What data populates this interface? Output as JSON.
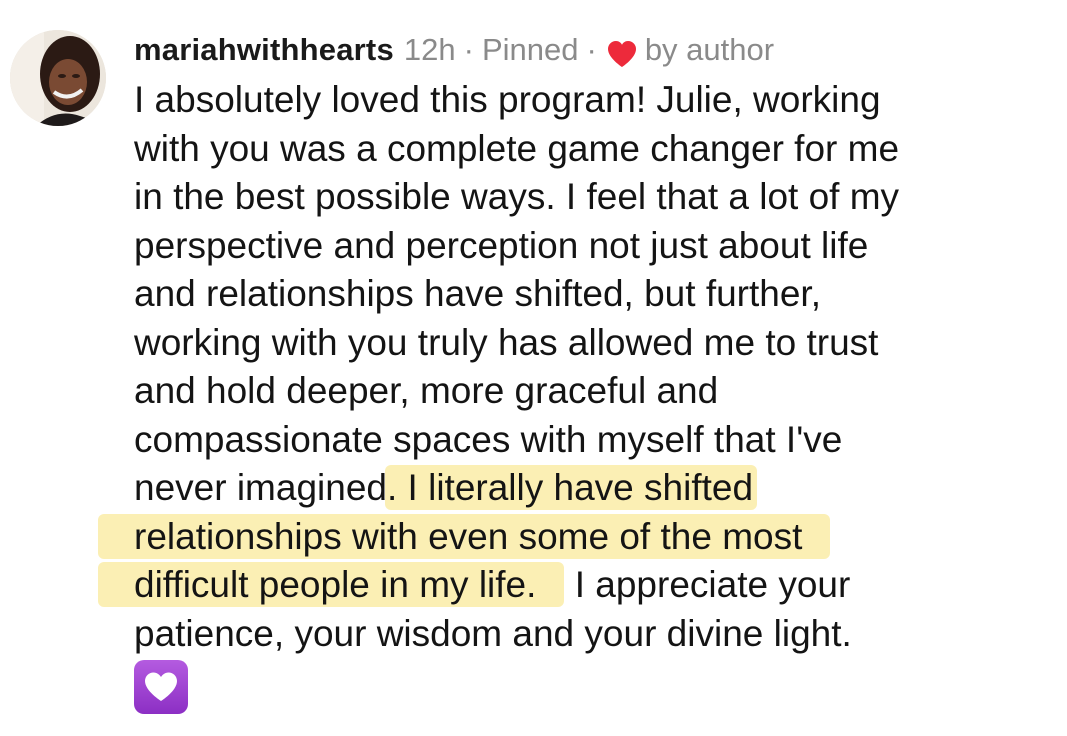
{
  "comment": {
    "username": "mariahwithhearts",
    "time": "12h",
    "separator": "·",
    "pinned": "Pinned",
    "liked_by": "by author",
    "colors": {
      "heart": "#ed2a3b",
      "highlight": "#fbefb4",
      "muted": "#8a8a8a",
      "emoji_purple": "#9d3fd2"
    },
    "lines": [
      "I absolutely loved this program! Julie, working",
      "with you was a complete game changer for me",
      "in the best possible ways. I feel that a lot of my",
      "perspective and perception not just about life",
      "and relationships have shifted, but further,",
      "working with you truly has allowed me to trust",
      "and hold deeper, more graceful and",
      "compassionate spaces with myself that I've"
    ],
    "line9_plain": "never imagined",
    "line9_highlight": ". I literally have shifted",
    "line10_highlight": "relationships with even some of the most",
    "line11_highlight": "difficult people in my life.",
    "line11_plain": " I appreciate your",
    "line12": "patience, your wisdom and your divine light.",
    "trailing_emoji": "purple-heart-icon"
  }
}
